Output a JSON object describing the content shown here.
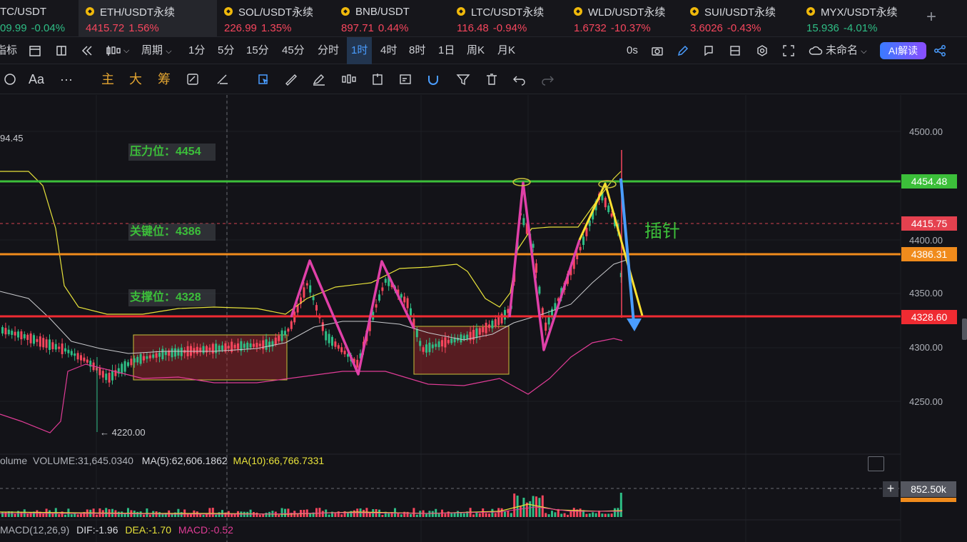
{
  "tabs": [
    {
      "symbol": "TC/USDT",
      "price": "09.99",
      "change": "-0.04%",
      "dir": "up"
    },
    {
      "symbol": "ETH/USDT永续",
      "price": "4415.72",
      "change": "1.56%",
      "dir": "down"
    },
    {
      "symbol": "SOL/USDT永续",
      "price": "226.99",
      "change": "1.35%",
      "dir": "down"
    },
    {
      "symbol": "BNB/USDT",
      "price": "897.71",
      "change": "0.44%",
      "dir": "down"
    },
    {
      "symbol": "LTC/USDT永续",
      "price": "116.48",
      "change": "-0.94%",
      "dir": "down"
    },
    {
      "symbol": "WLD/USDT永续",
      "price": "1.6732",
      "change": "-10.37%",
      "dir": "down"
    },
    {
      "symbol": "SUI/USDT永续",
      "price": "3.6026",
      "change": "-0.43%",
      "dir": "down"
    },
    {
      "symbol": "MYX/USDT永续",
      "price": "15.936",
      "change": "-4.01%",
      "dir": "up"
    }
  ],
  "add_tab": "+",
  "toolbar": {
    "indicator": "指标",
    "period": "周期",
    "intervals": [
      "1分",
      "5分",
      "15分",
      "45分",
      "分时",
      "1时",
      "4时",
      "8时",
      "1日",
      "周K",
      "月K"
    ],
    "selected_interval": "1时",
    "countdown": "0s",
    "layout_name": "未命名",
    "ai_button": "AI解读"
  },
  "drawbar": {
    "text_tool": "Aa",
    "more": "···",
    "main": "主",
    "big": "大",
    "chip": "筹"
  },
  "price_axis": {
    "ticks": [
      "4500.00",
      "4400.00",
      "4350.00",
      "4300.00",
      "4250.00"
    ]
  },
  "price_tags": {
    "pressure": {
      "text": "4454.48",
      "color": "#3cbf3a"
    },
    "last": {
      "text": "4415.75",
      "color": "#e5414f"
    },
    "key": {
      "text": "4386.31",
      "color": "#f08b1c"
    },
    "support": {
      "text": "4328.60",
      "color": "#ef2b32"
    }
  },
  "levels": {
    "pressure_label": "压力位：4454",
    "key_label": "关键位：4386",
    "support_label": "支撑位：4328"
  },
  "annotations": {
    "left_high": "94.45",
    "low_marker": "← 4220.00",
    "needle": "插针"
  },
  "volume": {
    "legend_name": "olume",
    "volume": "VOLUME:31,645.0340",
    "ma5": "MA(5):62,606.1862",
    "ma10": "MA(10):66,766.7331",
    "tag": "852.50k"
  },
  "macd": {
    "name": "MACD(12,26,9)",
    "dif": "DIF:-1.96",
    "dea": "DEA:-1.70",
    "macd": "MACD:-0.52"
  }
}
